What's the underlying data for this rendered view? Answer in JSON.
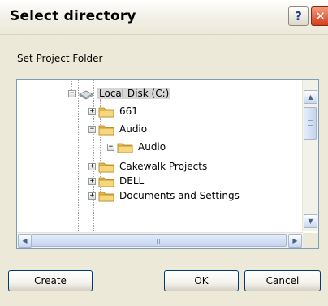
{
  "window": {
    "title": "Select directory",
    "help_label": "?",
    "close_label": "✕"
  },
  "prompt": "Set Project Folder",
  "tree": {
    "items": [
      {
        "label": "Local Disk (C:)",
        "expander": "−",
        "icon": "hard-drive-icon"
      },
      {
        "label": "661",
        "expander": "+",
        "icon": "folder-icon"
      },
      {
        "label": "Audio",
        "expander": "−",
        "icon": "folder-icon"
      },
      {
        "label": "Audio",
        "expander": "−",
        "icon": "folder-icon"
      },
      {
        "label": "Cakewalk Projects",
        "expander": "+",
        "icon": "folder-icon"
      },
      {
        "label": "DELL",
        "expander": "+",
        "icon": "folder-icon"
      },
      {
        "label": "Documents and Settings",
        "expander": "+",
        "icon": "folder-icon"
      }
    ],
    "selected": "Local Disk (C:)"
  },
  "scroll": {
    "up": "▲",
    "down": "▼",
    "left": "◀",
    "right": "▶"
  },
  "buttons": {
    "create": "Create",
    "ok": "OK",
    "cancel": "Cancel"
  },
  "colors": {
    "dialog_bg": "#ECE9D8",
    "folder": "#F4D36B",
    "button_border": "#003C74",
    "close": "#D63C1A"
  }
}
